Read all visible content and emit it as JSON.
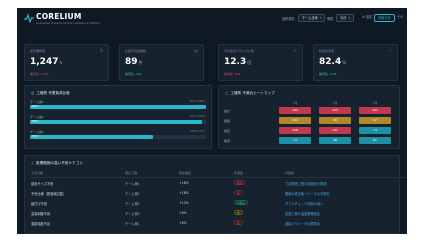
{
  "header": {
    "brand": "CORELIUM",
    "tagline": "Al-Assisted Cross-Functional Intelligence Platform",
    "updated": "最終更新",
    "scope_value": "チーム全体",
    "period_label": "期間",
    "period_value": "今月",
    "settings": "設定",
    "report": "詳細分析",
    "more": "その"
  },
  "kpis": [
    {
      "label": "総作業時間",
      "value": "1,247",
      "unit": "h",
      "delta": "前月比 -3.1%",
      "trend": "down"
    },
    {
      "label": "仕様不足指摘数",
      "value": "89",
      "unit": "件",
      "delta": "前月比 +12",
      "trend": "up"
    },
    {
      "label": "平均手戻りサイクル数",
      "value": "12.3",
      "unit": "回",
      "delta": "前月比 -0.6",
      "trend": "down"
    },
    {
      "label": "仕様充足率",
      "value": "82.4",
      "unit": "%",
      "delta": "前月比 +2.8",
      "trend": "up"
    }
  ],
  "load_panel": {
    "title": "工種別 作業負荷比較",
    "bars": [
      {
        "label": "チーム第1",
        "pct": 100,
        "value_text": "487h (39%)",
        "fill": "BEST"
      },
      {
        "label": "チーム第2",
        "pct": 98,
        "value_text": "421h (34%)",
        "fill": "BEST"
      },
      {
        "label": "チーム第3",
        "pct": 70,
        "value_text": "339h (27%)",
        "fill": "BEST"
      }
    ]
  },
  "heatmap": {
    "title": "工種別 不適合ヒートマップ",
    "columns": [
      "1月",
      "2月",
      "3月"
    ],
    "rows": [
      {
        "label": "設計",
        "cells": [
          {
            "value": "182",
            "level": "high"
          },
          {
            "value": "153",
            "level": "high"
          },
          {
            "value": "161",
            "level": "high"
          }
        ]
      },
      {
        "label": "製造",
        "cells": [
          {
            "value": "102",
            "level": "mid"
          },
          {
            "value": "88",
            "level": "mid"
          },
          {
            "value": "97",
            "level": "mid"
          }
        ]
      },
      {
        "label": "検査",
        "cells": [
          {
            "value": "156",
            "level": "high"
          },
          {
            "value": "141",
            "level": "high"
          },
          {
            "value": "74",
            "level": "low"
          }
        ]
      },
      {
        "label": "物流",
        "cells": [
          {
            "value": "73",
            "level": "low"
          },
          {
            "value": "48",
            "level": "low"
          },
          {
            "value": "61",
            "level": "low"
          }
        ]
      }
    ]
  },
  "table": {
    "title": "影響範囲の高い不良ケテゴリ",
    "columns": [
      "不良分類",
      "発生工程",
      "発生頻度",
      "影響度",
      "対策案"
    ],
    "rows": [
      {
        "category": "部品サイズ不良",
        "process": "チーム第1",
        "freq": "+18%",
        "freq_trend": "down",
        "impact": "最高",
        "impact_level": "red",
        "action": "寸法検査工程の自動化を実施"
      },
      {
        "category": "不良仕様（図面誤記載）",
        "process": "チーム第2",
        "freq": "+18%",
        "freq_trend": "down",
        "impact": "高",
        "impact_level": "red",
        "action": "図面の修正版リリースの手順化"
      },
      {
        "category": "組付け不良",
        "process": "チーム第2",
        "freq": "+12%",
        "freq_trend": "down",
        "impact": "中程度",
        "impact_level": "green",
        "action": "ダブルチェック体制の導入"
      },
      {
        "category": "塗装剥離不良",
        "process": "チーム第3",
        "freq": "+8%",
        "freq_trend": "down",
        "impact": "中",
        "impact_level": "amber",
        "action": "塗装工程の温度管理強化"
      },
      {
        "category": "溶接強度不足",
        "process": "チーム第1",
        "freq": "+6%",
        "freq_trend": "down",
        "impact": "高",
        "impact_level": "red",
        "action": "溶接パラメータの標準化"
      }
    ]
  },
  "colors": {
    "accent": "#2bb5c8",
    "bg": "#0f1923",
    "card": "#16222e",
    "danger": "#e0556b",
    "ok": "#3ccf91",
    "warn": "#e3b23c"
  }
}
